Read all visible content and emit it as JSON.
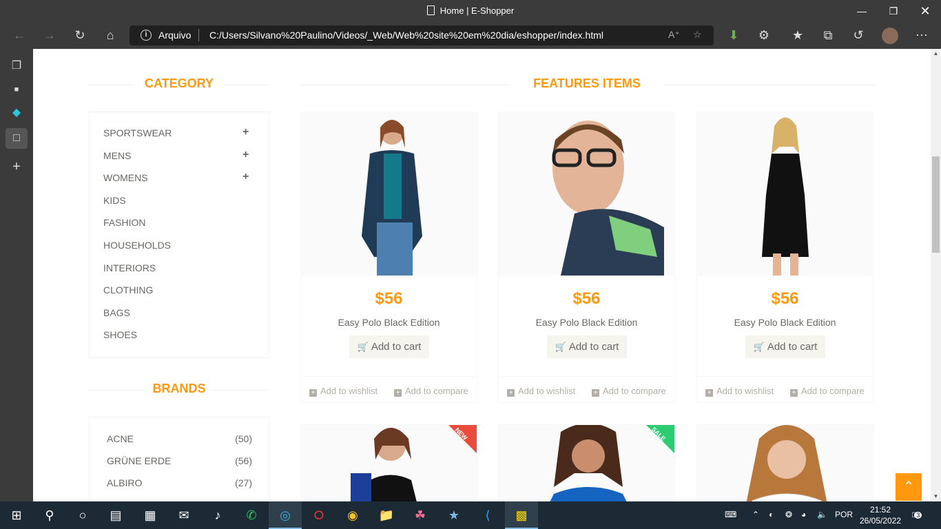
{
  "window": {
    "title": "Home | E-Shopper"
  },
  "address": {
    "protocol_label": "Arquivo",
    "url": "C:/Users/Silvano%20Paulino/Videos/_Web/Web%20site%20em%20dia/eshopper/index.html"
  },
  "sidebar": {
    "category_heading": "CATEGORY",
    "categories": [
      {
        "label": "SPORTSWEAR",
        "expandable": true
      },
      {
        "label": "MENS",
        "expandable": true
      },
      {
        "label": "WOMENS",
        "expandable": true
      },
      {
        "label": "KIDS"
      },
      {
        "label": "FASHION"
      },
      {
        "label": "HOUSEHOLDS"
      },
      {
        "label": "INTERIORS"
      },
      {
        "label": "CLOTHING"
      },
      {
        "label": "BAGS"
      },
      {
        "label": "SHOES"
      }
    ],
    "brands_heading": "BRANDS",
    "brands": [
      {
        "label": "ACNE",
        "count": "(50)"
      },
      {
        "label": "GRÜNE ERDE",
        "count": "(56)"
      },
      {
        "label": "ALBIRO",
        "count": "(27)"
      }
    ]
  },
  "main": {
    "heading": "FEATURES ITEMS",
    "products": [
      {
        "price": "$56",
        "name": "Easy Polo Black Edition",
        "cart": "Add to cart",
        "wishlist": "Add to wishlist",
        "compare": "Add to compare"
      },
      {
        "price": "$56",
        "name": "Easy Polo Black Edition",
        "cart": "Add to cart",
        "wishlist": "Add to wishlist",
        "compare": "Add to compare"
      },
      {
        "price": "$56",
        "name": "Easy Polo Black Edition",
        "cart": "Add to cart",
        "wishlist": "Add to wishlist",
        "compare": "Add to compare"
      }
    ],
    "badges": {
      "new": "NEW",
      "sale": "SALE"
    }
  },
  "colors": {
    "accent": "#fe980f",
    "new_badge": "#e74c3c",
    "sale_badge": "#2ecc71"
  },
  "taskbar": {
    "language": "POR",
    "time": "21:52",
    "date": "26/05/2022",
    "notifications": "3"
  }
}
